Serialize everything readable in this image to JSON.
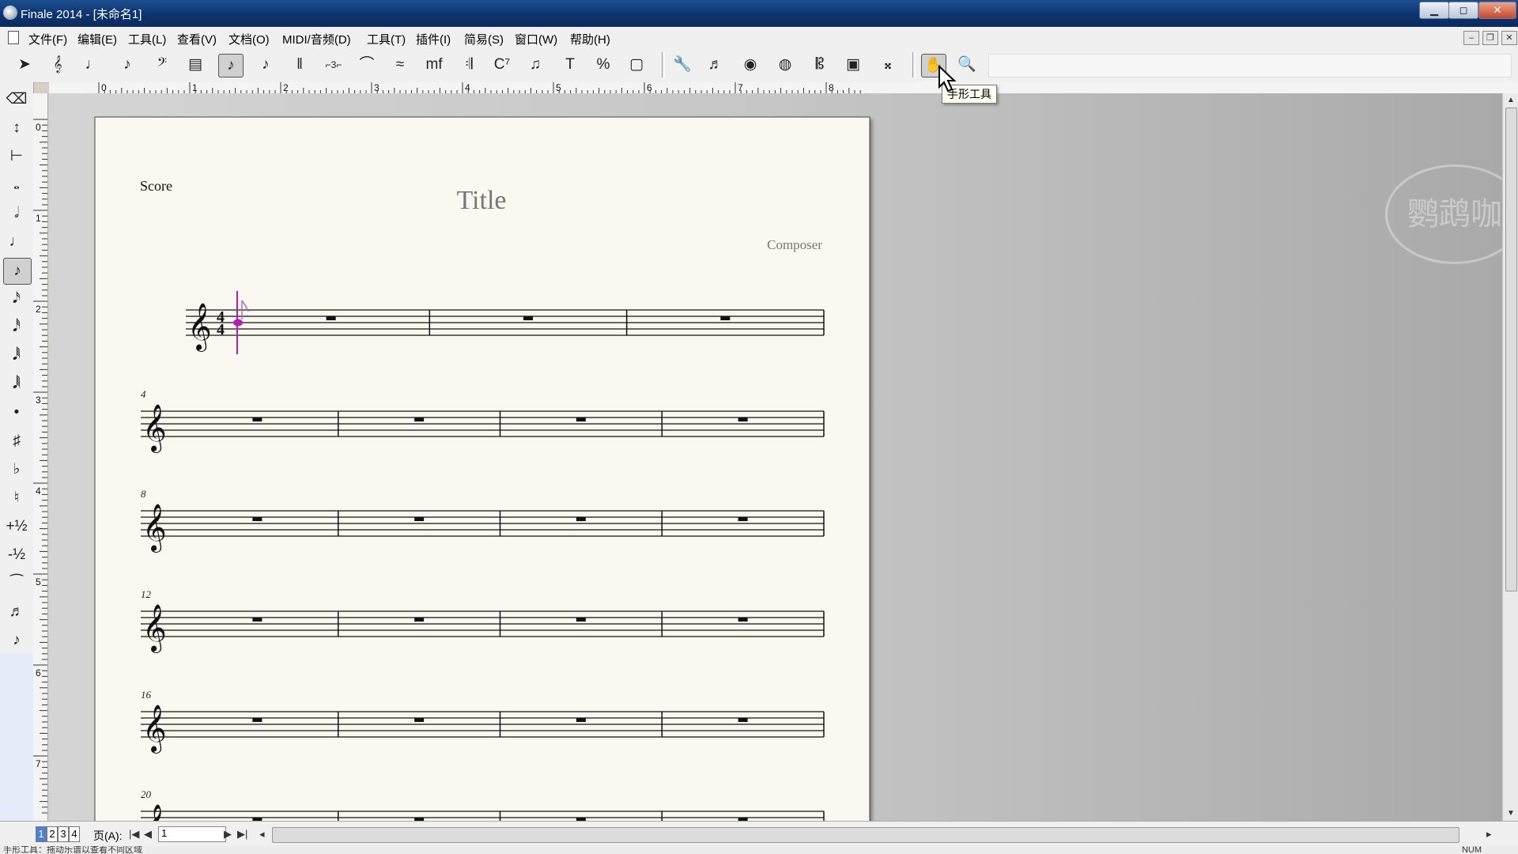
{
  "window": {
    "title": "Finale 2014 - [未命名1]"
  },
  "menubar": [
    "文件(F)",
    "编辑(E)",
    "工具(L)",
    "查看(V)",
    "文档(O)",
    "MIDI/音频(D)",
    "工具(T)",
    "插件(I)",
    "简易(S)",
    "窗口(W)",
    "帮助(H)"
  ],
  "toolbar": {
    "tools": [
      {
        "name": "selection-tool",
        "glyph": "➤"
      },
      {
        "name": "staff-tool",
        "glyph": "𝄞"
      },
      {
        "name": "simple-entry-tool",
        "glyph": "♩"
      },
      {
        "name": "speedy-entry-tool",
        "glyph": "♪"
      },
      {
        "name": "clef-tool",
        "glyph": "𝄢"
      },
      {
        "name": "time-signature-tool",
        "glyph": "▤"
      },
      {
        "name": "simple-entry-active-tool",
        "glyph": "♪"
      },
      {
        "name": "tuplet-tool",
        "glyph": "♪"
      },
      {
        "name": "measure-tool",
        "glyph": "‖"
      },
      {
        "name": "tuplet-3-tool",
        "glyph": "⌐3⌐"
      },
      {
        "name": "smart-shape-tool",
        "glyph": "⌒"
      },
      {
        "name": "articulation-tool",
        "glyph": "≈"
      },
      {
        "name": "expression-tool",
        "glyph": "mf"
      },
      {
        "name": "repeat-tool",
        "glyph": "𝄇"
      },
      {
        "name": "chord-tool",
        "glyph": "C⁷"
      },
      {
        "name": "lyrics-tool",
        "glyph": "♫"
      },
      {
        "name": "text-tool",
        "glyph": "T"
      },
      {
        "name": "resize-tool",
        "glyph": "%"
      },
      {
        "name": "page-layout-tool",
        "glyph": "▢"
      },
      {
        "name": "special-tools",
        "glyph": "🔧"
      },
      {
        "name": "mirror-tool",
        "glyph": "♬"
      },
      {
        "name": "note-mover-tool",
        "glyph": "◉"
      },
      {
        "name": "graphics-tool",
        "glyph": "◍"
      },
      {
        "name": "ossia-tool",
        "glyph": "𝄡"
      },
      {
        "name": "midi-tool",
        "glyph": "▣"
      },
      {
        "name": "human-playback-tool",
        "glyph": "𝄪"
      },
      {
        "name": "hand-grabber-tool",
        "glyph": "✋"
      },
      {
        "name": "zoom-tool",
        "glyph": "🔍"
      }
    ],
    "tooltip": "手形工具"
  },
  "ruler": {
    "labels": [
      "0",
      "1",
      "2",
      "3",
      "4",
      "5",
      "6",
      "7",
      "8"
    ]
  },
  "palette": [
    {
      "name": "eraser-tool",
      "glyph": "⌫"
    },
    {
      "name": "note-up-down-tool",
      "glyph": "↕"
    },
    {
      "name": "rest-tool",
      "glyph": "⊢"
    },
    {
      "name": "whole-note-tool",
      "glyph": "𝅝"
    },
    {
      "name": "half-note-tool",
      "glyph": "𝅗𝅥"
    },
    {
      "name": "quarter-note-tool",
      "glyph": "♩"
    },
    {
      "name": "eighth-note-tool",
      "glyph": "♪"
    },
    {
      "name": "sixteenth-note-tool",
      "glyph": "𝅘𝅥𝅯"
    },
    {
      "name": "thirty-second-note-tool",
      "glyph": "𝅘𝅥𝅰"
    },
    {
      "name": "sixty-fourth-note-tool",
      "glyph": "𝅘𝅥𝅱"
    },
    {
      "name": "hundred-twenty-eighth-note-tool",
      "glyph": "𝅘𝅥𝅲"
    },
    {
      "name": "dot-tool",
      "glyph": "•"
    },
    {
      "name": "sharp-tool",
      "glyph": "♯"
    },
    {
      "name": "flat-tool",
      "glyph": "♭"
    },
    {
      "name": "natural-tool",
      "glyph": "♮"
    },
    {
      "name": "half-step-up-tool",
      "glyph": "+½"
    },
    {
      "name": "half-step-down-tool",
      "glyph": "-½"
    },
    {
      "name": "tie-tool",
      "glyph": "⁀"
    },
    {
      "name": "tuplet-palette-tool",
      "glyph": "♬"
    },
    {
      "name": "grace-note-tool",
      "glyph": "♪"
    }
  ],
  "score": {
    "header": "Score",
    "title": "Title",
    "composer": "Composer",
    "clef": "𝄞",
    "time_signature": [
      "4",
      "4"
    ],
    "systems": [
      {
        "number": "",
        "measures": 3
      },
      {
        "number": "4",
        "measures": 4
      },
      {
        "number": "8",
        "measures": 4
      },
      {
        "number": "12",
        "measures": 4
      },
      {
        "number": "16",
        "measures": 4
      },
      {
        "number": "20",
        "measures": 4
      }
    ],
    "cursor_color": "#b01fae"
  },
  "bottombar": {
    "page_tabs": [
      "1",
      "2",
      "3",
      "4"
    ],
    "page_label": "页(A):",
    "page_value": "1"
  },
  "statusbar": {
    "text": "手形工具：拖动乐谱以查看不同区域",
    "num": "NUM"
  },
  "colors": {
    "titlebar": "#0d3470",
    "page": "#faf8f0",
    "accent": "#b01fae"
  }
}
